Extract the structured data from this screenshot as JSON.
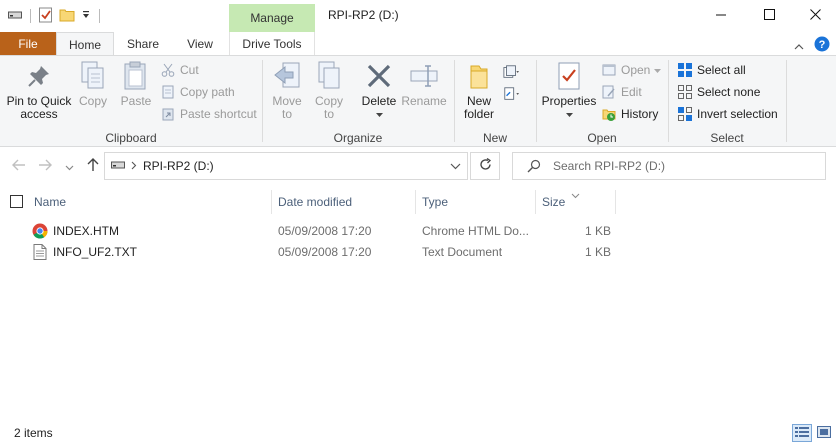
{
  "window": {
    "title": "RPI-RP2 (D:)",
    "context_tab": "Manage"
  },
  "tabs": {
    "file": "File",
    "home": "Home",
    "share": "Share",
    "view": "View",
    "drive_tools": "Drive Tools"
  },
  "ribbon": {
    "clipboard": {
      "pin_line1": "Pin to Quick",
      "pin_line2": "access",
      "copy": "Copy",
      "paste": "Paste",
      "cut": "Cut",
      "copy_path": "Copy path",
      "paste_shortcut": "Paste shortcut",
      "group": "Clipboard"
    },
    "organize": {
      "move_line1": "Move",
      "move_line2": "to",
      "copy_line1": "Copy",
      "copy_line2": "to",
      "delete": "Delete",
      "rename": "Rename",
      "group": "Organize"
    },
    "new": {
      "folder_line1": "New",
      "folder_line2": "folder",
      "group": "New"
    },
    "open": {
      "properties": "Properties",
      "open": "Open",
      "edit": "Edit",
      "history": "History",
      "group": "Open"
    },
    "select": {
      "select_all": "Select all",
      "select_none": "Select none",
      "invert": "Invert selection",
      "group": "Select"
    }
  },
  "address": {
    "location": "RPI-RP2 (D:)",
    "search_placeholder": "Search RPI-RP2 (D:)"
  },
  "columns": {
    "name": "Name",
    "date": "Date modified",
    "type": "Type",
    "size": "Size"
  },
  "files": [
    {
      "name": "INDEX.HTM",
      "date": "05/09/2008 17:20",
      "type": "Chrome HTML Do...",
      "size": "1 KB",
      "icon": "chrome-icon"
    },
    {
      "name": "INFO_UF2.TXT",
      "date": "05/09/2008 17:20",
      "type": "Text Document",
      "size": "1 KB",
      "icon": "text-document-icon"
    }
  ],
  "status": {
    "count": "2 items"
  },
  "colors": {
    "file_tab": "#b9621a",
    "manage_tab": "#c6e9b3",
    "header_text": "#4c607a",
    "accent": "#1a73d8"
  }
}
